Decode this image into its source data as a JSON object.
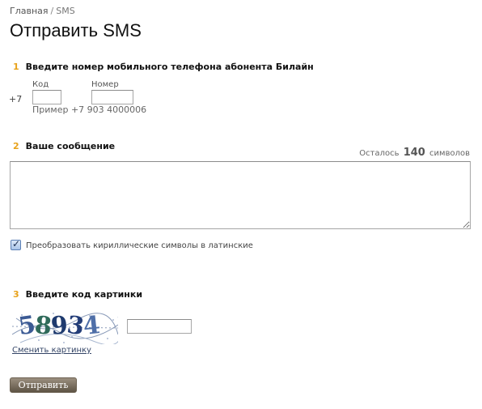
{
  "breadcrumb": {
    "home": "Главная",
    "separator": "/",
    "current": "SMS"
  },
  "title": "Отправить SMS",
  "step1": {
    "number": "1",
    "title": "Введите номер мобильного телефона абонента Билайн",
    "prefix": "+7",
    "code_label": "Код",
    "number_label": "Номер",
    "code_value": "",
    "number_value": "",
    "hint": "Пример +7 903 4000006"
  },
  "step2": {
    "number": "2",
    "title": "Ваше сообщение",
    "remaining_prefix": "Осталось",
    "remaining_count": "140",
    "remaining_suffix": "символов",
    "message_value": "",
    "transliterate_label": "Преобразовать кириллические символы в латинские",
    "transliterate_checked": true
  },
  "step3": {
    "number": "3",
    "title": "Введите код картинки",
    "captcha_text": "58934",
    "code_value": "",
    "change_link": "Сменить картинку"
  },
  "submit_label": "Отправить",
  "colors": {
    "step_number": "#e8a21a",
    "button_top": "#9b8f7f",
    "button_bottom": "#5e5445",
    "link": "#334466"
  }
}
